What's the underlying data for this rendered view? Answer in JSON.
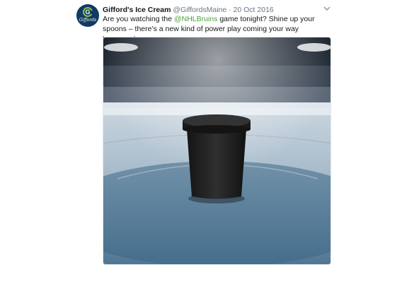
{
  "tweet": {
    "author_name": "Gifford's Ice Cream",
    "handle": "@GiffordsMaine",
    "separator": "·",
    "date": "20 Oct 2016",
    "text_before": "Are you watching the ",
    "mention": "@NHLBruins",
    "text_after": " game tonight? Shine up your spoons – there’s a new kind of power play coming your way tomorrow!",
    "avatar_initial": "G",
    "avatar_wordmark": "Giffords",
    "menu_icon": "chevron-down-icon",
    "mention_color": "#4f9e3c"
  },
  "media": {
    "description_icon": "image",
    "subject": "black ice cream pint on hockey rink ice"
  }
}
